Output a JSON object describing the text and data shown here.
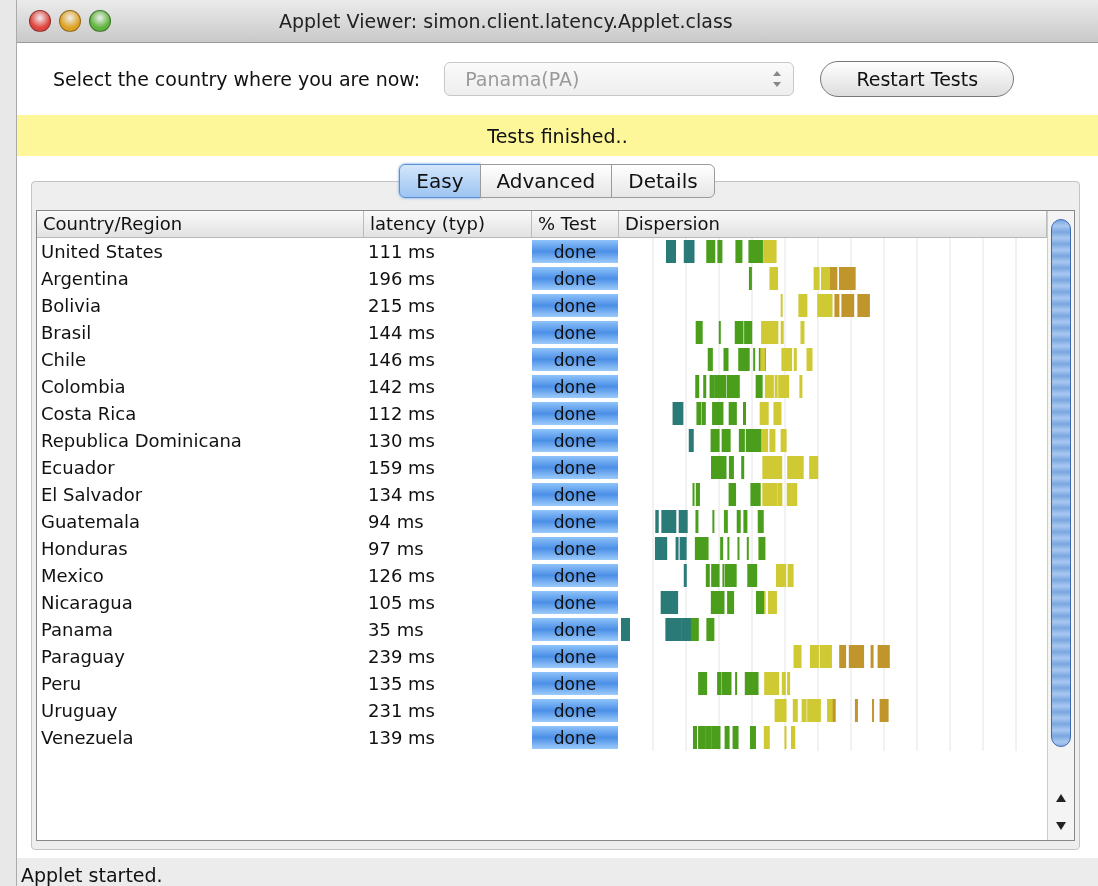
{
  "window": {
    "title": "Applet Viewer: simon.client.latency.Applet.class"
  },
  "country_select": {
    "label": "Select the country where you are now:",
    "value": "Panama(PA)",
    "disabled": true
  },
  "restart_button": "Restart Tests",
  "banner": "Tests finished..",
  "tabs": [
    {
      "label": "Easy",
      "selected": true
    },
    {
      "label": "Advanced",
      "selected": false
    },
    {
      "label": "Details",
      "selected": false
    }
  ],
  "table": {
    "columns": [
      "Country/Region",
      "latency (typ)",
      "% Test",
      "Dispersion"
    ],
    "rows": [
      {
        "country": "United States",
        "latency": "111 ms",
        "test": "done",
        "level": 1
      },
      {
        "country": "Argentina",
        "latency": "196 ms",
        "test": "done",
        "level": 1
      },
      {
        "country": "Bolivia",
        "latency": "215 ms",
        "test": "done",
        "level": 1
      },
      {
        "country": "Brasil",
        "latency": "144 ms",
        "test": "done",
        "level": 1
      },
      {
        "country": "Chile",
        "latency": "146 ms",
        "test": "done",
        "level": 1
      },
      {
        "country": "Colombia",
        "latency": "142 ms",
        "test": "done",
        "level": 1
      },
      {
        "country": "Costa Rica",
        "latency": "112 ms",
        "test": "done",
        "level": 1
      },
      {
        "country": "Republica Dominicana",
        "latency": "130 ms",
        "test": "done",
        "level": 1
      },
      {
        "country": "Ecuador",
        "latency": "159 ms",
        "test": "done",
        "level": 1
      },
      {
        "country": "El Salvador",
        "latency": "134 ms",
        "test": "done",
        "level": 1
      },
      {
        "country": "Guatemala",
        "latency": "94 ms",
        "test": "done",
        "level": 1
      },
      {
        "country": "Honduras",
        "latency": "97 ms",
        "test": "done",
        "level": 1
      },
      {
        "country": "Mexico",
        "latency": "126 ms",
        "test": "done",
        "level": 1
      },
      {
        "country": "Nicaragua",
        "latency": "105 ms",
        "test": "done",
        "level": 1
      },
      {
        "country": "Panama",
        "latency": "35 ms",
        "test": "done",
        "level": 1
      },
      {
        "country": "Paraguay",
        "latency": "239 ms",
        "test": "done",
        "level": 1
      },
      {
        "country": "Peru",
        "latency": "135 ms",
        "test": "done",
        "level": 1
      },
      {
        "country": "Uruguay",
        "latency": "231 ms",
        "test": "done",
        "level": 1
      },
      {
        "country": "Venezuela",
        "latency": "139 ms",
        "test": "done",
        "level": 1
      }
    ]
  },
  "status_bar": "Applet started."
}
